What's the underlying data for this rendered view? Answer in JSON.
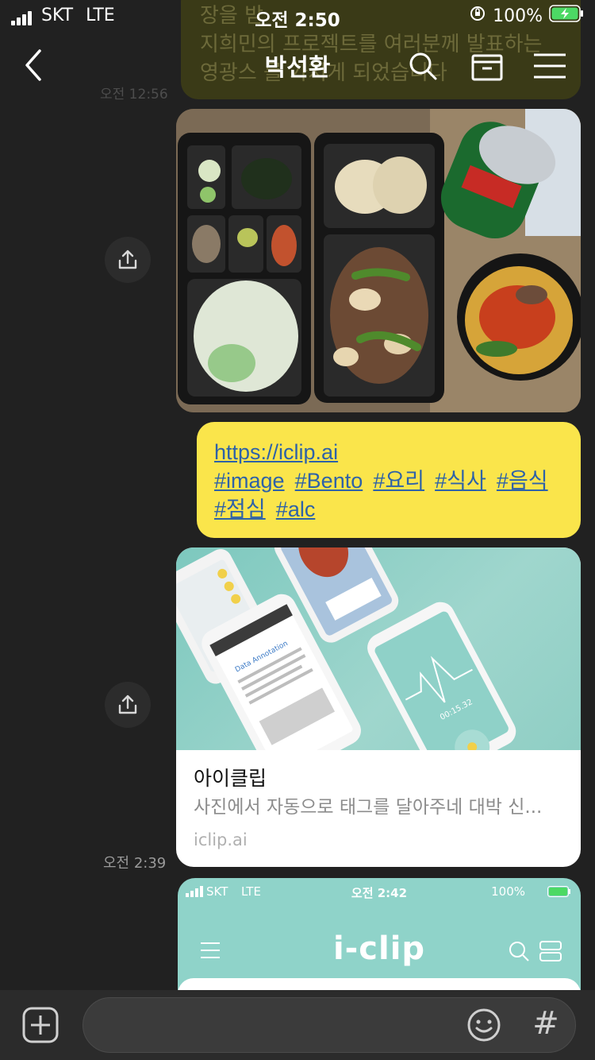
{
  "status_bar": {
    "carrier": "SKT",
    "network": "LTE",
    "time": "오전 2:50",
    "battery": "100%"
  },
  "header": {
    "title": "박선환",
    "icons": [
      "back-icon",
      "search-icon",
      "drawer-icon",
      "menu-icon"
    ]
  },
  "previous_message": {
    "lines": [
      "장을 받",
      "지희민의 프로젝트를 여러분께 발표하는",
      "영광스         를 가지게 되었습니다"
    ],
    "time": "오전 12:56"
  },
  "tag_message": {
    "link": "https://iclip.ai",
    "tags_line1": [
      "#image",
      "#Bento",
      "#요리",
      "#식사",
      "#음식"
    ],
    "tags_line2": [
      "#점심",
      "#alc"
    ]
  },
  "link_card": {
    "title": "아이클립",
    "description": "사진에서 자동으로 태그를 달아주네 대박 신...",
    "domain": "iclip.ai",
    "image_texts": {
      "data_annotation": "Data Annotation",
      "timer": "00:15.32"
    },
    "time": "오전 2:39"
  },
  "screenshot_message": {
    "carrier": "SKT",
    "network": "LTE",
    "time": "오전 2:42",
    "battery": "100%",
    "logo": "i-clip"
  },
  "input_bar": {
    "hash_label": "#"
  },
  "colors": {
    "background": "#212121",
    "my_bubble": "#fae54b",
    "link": "#2e62a8",
    "battery_green": "#4cd964"
  }
}
